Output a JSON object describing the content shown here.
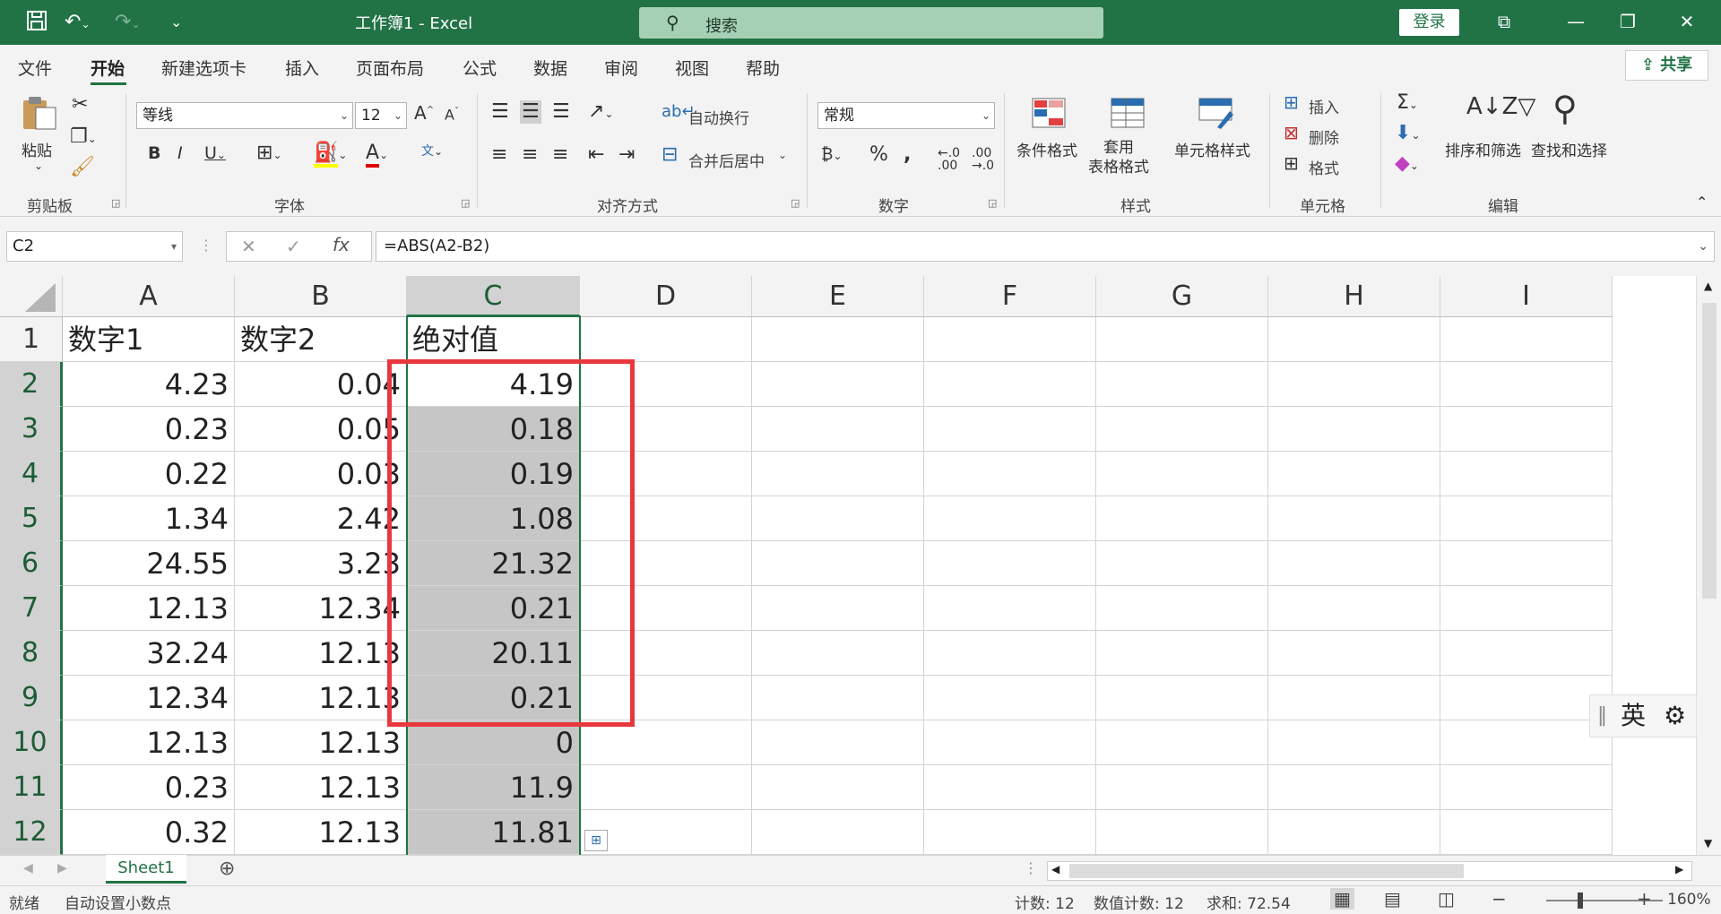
{
  "app": {
    "title": "工作簿1 - Excel",
    "login_label": "登录",
    "search_placeholder": "搜索",
    "accent": "#217346"
  },
  "menu": {
    "items": [
      "文件",
      "开始",
      "新建选项卡",
      "插入",
      "页面布局",
      "公式",
      "数据",
      "审阅",
      "视图",
      "帮助"
    ],
    "active": "开始",
    "share_label": "共享"
  },
  "ribbon": {
    "clipboard": {
      "paste_label": "粘贴",
      "group": "剪贴板"
    },
    "font": {
      "font_name": "等线",
      "font_size": "12",
      "group": "字体"
    },
    "alignment": {
      "wrap_label": "自动换行",
      "merge_label": "合并后居中",
      "group": "对齐方式"
    },
    "number": {
      "format": "常规",
      "group": "数字"
    },
    "styles": {
      "conditional_label": "条件格式",
      "table_format_label": "套用\n表格格式",
      "cell_styles_label": "单元格样式",
      "group": "样式"
    },
    "cells": {
      "insert_label": "插入",
      "delete_label": "删除",
      "format_label": "格式",
      "group": "单元格"
    },
    "editing": {
      "sort_label": "排序和筛选",
      "find_label": "查找和选择",
      "group": "编辑"
    }
  },
  "formula_bar": {
    "name_box": "C2",
    "formula": "=ABS(A2-B2)"
  },
  "sheet": {
    "columns": [
      "A",
      "B",
      "C",
      "D",
      "E",
      "F",
      "G",
      "H",
      "I"
    ],
    "selected_column": "C",
    "rows": [
      {
        "n": "1",
        "a": "数字1",
        "b": "数字2",
        "c": "绝对值"
      },
      {
        "n": "2",
        "a": "4.23",
        "b": "0.04",
        "c": "4.19"
      },
      {
        "n": "3",
        "a": "0.23",
        "b": "0.05",
        "c": "0.18"
      },
      {
        "n": "4",
        "a": "0.22",
        "b": "0.03",
        "c": "0.19"
      },
      {
        "n": "5",
        "a": "1.34",
        "b": "2.42",
        "c": "1.08"
      },
      {
        "n": "6",
        "a": "24.55",
        "b": "3.23",
        "c": "21.32"
      },
      {
        "n": "7",
        "a": "12.13",
        "b": "12.34",
        "c": "0.21"
      },
      {
        "n": "8",
        "a": "32.24",
        "b": "12.13",
        "c": "20.11"
      },
      {
        "n": "9",
        "a": "12.34",
        "b": "12.13",
        "c": "0.21"
      },
      {
        "n": "10",
        "a": "12.13",
        "b": "12.13",
        "c": "0"
      },
      {
        "n": "11",
        "a": "0.23",
        "b": "12.13",
        "c": "11.9"
      },
      {
        "n": "12",
        "a": "0.32",
        "b": "12.13",
        "c": "11.81"
      }
    ]
  },
  "ime": {
    "label": "英"
  },
  "tabs": {
    "sheet1": "Sheet1"
  },
  "status": {
    "ready": "就绪",
    "auto_decimal": "自动设置小数点",
    "count": "计数: 12",
    "numeric_count": "数值计数: 12",
    "sum": "求和: 72.54",
    "zoom": "160%"
  }
}
